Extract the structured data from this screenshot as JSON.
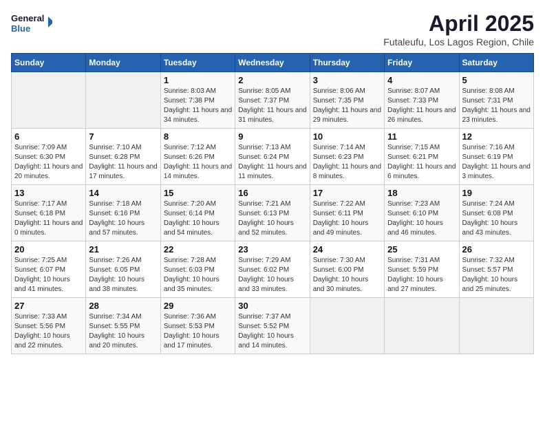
{
  "header": {
    "logo_text_general": "General",
    "logo_text_blue": "Blue",
    "month_year": "April 2025",
    "location": "Futaleufu, Los Lagos Region, Chile"
  },
  "calendar": {
    "weekdays": [
      "Sunday",
      "Monday",
      "Tuesday",
      "Wednesday",
      "Thursday",
      "Friday",
      "Saturday"
    ],
    "weeks": [
      [
        {
          "day": "",
          "empty": true
        },
        {
          "day": "",
          "empty": true
        },
        {
          "day": "1",
          "sunrise": "Sunrise: 8:03 AM",
          "sunset": "Sunset: 7:38 PM",
          "daylight": "Daylight: 11 hours and 34 minutes."
        },
        {
          "day": "2",
          "sunrise": "Sunrise: 8:05 AM",
          "sunset": "Sunset: 7:37 PM",
          "daylight": "Daylight: 11 hours and 31 minutes."
        },
        {
          "day": "3",
          "sunrise": "Sunrise: 8:06 AM",
          "sunset": "Sunset: 7:35 PM",
          "daylight": "Daylight: 11 hours and 29 minutes."
        },
        {
          "day": "4",
          "sunrise": "Sunrise: 8:07 AM",
          "sunset": "Sunset: 7:33 PM",
          "daylight": "Daylight: 11 hours and 26 minutes."
        },
        {
          "day": "5",
          "sunrise": "Sunrise: 8:08 AM",
          "sunset": "Sunset: 7:31 PM",
          "daylight": "Daylight: 11 hours and 23 minutes."
        }
      ],
      [
        {
          "day": "6",
          "sunrise": "Sunrise: 7:09 AM",
          "sunset": "Sunset: 6:30 PM",
          "daylight": "Daylight: 11 hours and 20 minutes."
        },
        {
          "day": "7",
          "sunrise": "Sunrise: 7:10 AM",
          "sunset": "Sunset: 6:28 PM",
          "daylight": "Daylight: 11 hours and 17 minutes."
        },
        {
          "day": "8",
          "sunrise": "Sunrise: 7:12 AM",
          "sunset": "Sunset: 6:26 PM",
          "daylight": "Daylight: 11 hours and 14 minutes."
        },
        {
          "day": "9",
          "sunrise": "Sunrise: 7:13 AM",
          "sunset": "Sunset: 6:24 PM",
          "daylight": "Daylight: 11 hours and 11 minutes."
        },
        {
          "day": "10",
          "sunrise": "Sunrise: 7:14 AM",
          "sunset": "Sunset: 6:23 PM",
          "daylight": "Daylight: 11 hours and 8 minutes."
        },
        {
          "day": "11",
          "sunrise": "Sunrise: 7:15 AM",
          "sunset": "Sunset: 6:21 PM",
          "daylight": "Daylight: 11 hours and 6 minutes."
        },
        {
          "day": "12",
          "sunrise": "Sunrise: 7:16 AM",
          "sunset": "Sunset: 6:19 PM",
          "daylight": "Daylight: 11 hours and 3 minutes."
        }
      ],
      [
        {
          "day": "13",
          "sunrise": "Sunrise: 7:17 AM",
          "sunset": "Sunset: 6:18 PM",
          "daylight": "Daylight: 11 hours and 0 minutes."
        },
        {
          "day": "14",
          "sunrise": "Sunrise: 7:18 AM",
          "sunset": "Sunset: 6:16 PM",
          "daylight": "Daylight: 10 hours and 57 minutes."
        },
        {
          "day": "15",
          "sunrise": "Sunrise: 7:20 AM",
          "sunset": "Sunset: 6:14 PM",
          "daylight": "Daylight: 10 hours and 54 minutes."
        },
        {
          "day": "16",
          "sunrise": "Sunrise: 7:21 AM",
          "sunset": "Sunset: 6:13 PM",
          "daylight": "Daylight: 10 hours and 52 minutes."
        },
        {
          "day": "17",
          "sunrise": "Sunrise: 7:22 AM",
          "sunset": "Sunset: 6:11 PM",
          "daylight": "Daylight: 10 hours and 49 minutes."
        },
        {
          "day": "18",
          "sunrise": "Sunrise: 7:23 AM",
          "sunset": "Sunset: 6:10 PM",
          "daylight": "Daylight: 10 hours and 46 minutes."
        },
        {
          "day": "19",
          "sunrise": "Sunrise: 7:24 AM",
          "sunset": "Sunset: 6:08 PM",
          "daylight": "Daylight: 10 hours and 43 minutes."
        }
      ],
      [
        {
          "day": "20",
          "sunrise": "Sunrise: 7:25 AM",
          "sunset": "Sunset: 6:07 PM",
          "daylight": "Daylight: 10 hours and 41 minutes."
        },
        {
          "day": "21",
          "sunrise": "Sunrise: 7:26 AM",
          "sunset": "Sunset: 6:05 PM",
          "daylight": "Daylight: 10 hours and 38 minutes."
        },
        {
          "day": "22",
          "sunrise": "Sunrise: 7:28 AM",
          "sunset": "Sunset: 6:03 PM",
          "daylight": "Daylight: 10 hours and 35 minutes."
        },
        {
          "day": "23",
          "sunrise": "Sunrise: 7:29 AM",
          "sunset": "Sunset: 6:02 PM",
          "daylight": "Daylight: 10 hours and 33 minutes."
        },
        {
          "day": "24",
          "sunrise": "Sunrise: 7:30 AM",
          "sunset": "Sunset: 6:00 PM",
          "daylight": "Daylight: 10 hours and 30 minutes."
        },
        {
          "day": "25",
          "sunrise": "Sunrise: 7:31 AM",
          "sunset": "Sunset: 5:59 PM",
          "daylight": "Daylight: 10 hours and 27 minutes."
        },
        {
          "day": "26",
          "sunrise": "Sunrise: 7:32 AM",
          "sunset": "Sunset: 5:57 PM",
          "daylight": "Daylight: 10 hours and 25 minutes."
        }
      ],
      [
        {
          "day": "27",
          "sunrise": "Sunrise: 7:33 AM",
          "sunset": "Sunset: 5:56 PM",
          "daylight": "Daylight: 10 hours and 22 minutes."
        },
        {
          "day": "28",
          "sunrise": "Sunrise: 7:34 AM",
          "sunset": "Sunset: 5:55 PM",
          "daylight": "Daylight: 10 hours and 20 minutes."
        },
        {
          "day": "29",
          "sunrise": "Sunrise: 7:36 AM",
          "sunset": "Sunset: 5:53 PM",
          "daylight": "Daylight: 10 hours and 17 minutes."
        },
        {
          "day": "30",
          "sunrise": "Sunrise: 7:37 AM",
          "sunset": "Sunset: 5:52 PM",
          "daylight": "Daylight: 10 hours and 14 minutes."
        },
        {
          "day": "",
          "empty": true
        },
        {
          "day": "",
          "empty": true
        },
        {
          "day": "",
          "empty": true
        }
      ]
    ]
  }
}
